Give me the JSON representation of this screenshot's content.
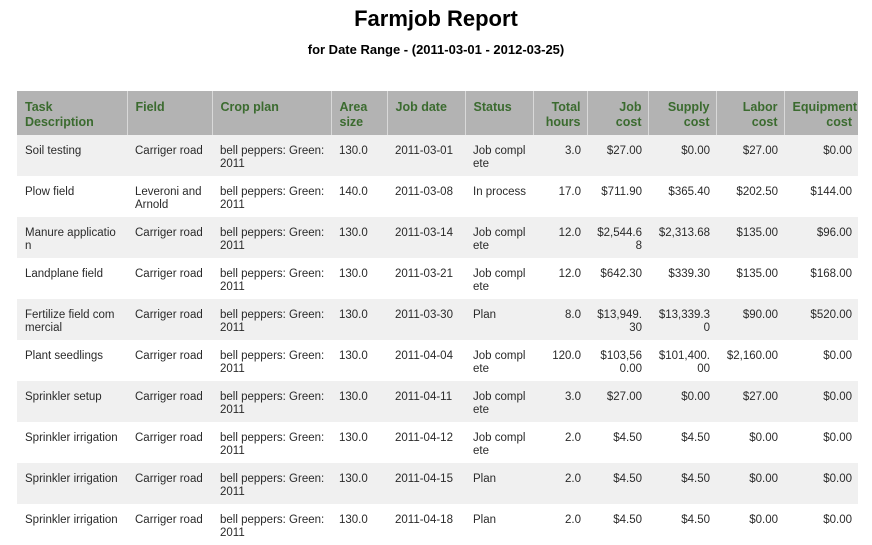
{
  "report": {
    "title": "Farmjob Report",
    "subtitle": "for Date Range - (2011-03-01 - 2012-03-25)"
  },
  "columns": [
    {
      "label": "Task Description",
      "align": "left"
    },
    {
      "label": "Field",
      "align": "left"
    },
    {
      "label": "Crop plan",
      "align": "left"
    },
    {
      "label": "Area size",
      "align": "left"
    },
    {
      "label": "Job date",
      "align": "left"
    },
    {
      "label": "Status",
      "align": "left"
    },
    {
      "label": "Total hours",
      "align": "right"
    },
    {
      "label": "Job cost",
      "align": "right"
    },
    {
      "label": "Supply cost",
      "align": "right"
    },
    {
      "label": "Labor cost",
      "align": "right"
    },
    {
      "label": "Equipment cost",
      "align": "right"
    }
  ],
  "rows": [
    [
      "Soil testing",
      "Carriger road",
      "bell peppers: Green: 2011",
      "130.0",
      "2011-03-01",
      "Job complete",
      "3.0",
      "$27.00",
      "$0.00",
      "$27.00",
      "$0.00"
    ],
    [
      "Plow field",
      "Leveroni and Arnold",
      "bell peppers: Green: 2011",
      "140.0",
      "2011-03-08",
      "In process",
      "17.0",
      "$711.90",
      "$365.40",
      "$202.50",
      "$144.00"
    ],
    [
      "Manure application",
      "Carriger road",
      "bell peppers: Green: 2011",
      "130.0",
      "2011-03-14",
      "Job complete",
      "12.0",
      "$2,544.68",
      "$2,313.68",
      "$135.00",
      "$96.00"
    ],
    [
      "Landplane field",
      "Carriger road",
      "bell peppers: Green: 2011",
      "130.0",
      "2011-03-21",
      "Job complete",
      "12.0",
      "$642.30",
      "$339.30",
      "$135.00",
      "$168.00"
    ],
    [
      "Fertilize field commercial",
      "Carriger road",
      "bell peppers: Green: 2011",
      "130.0",
      "2011-03-30",
      "Plan",
      "8.0",
      "$13,949.30",
      "$13,339.30",
      "$90.00",
      "$520.00"
    ],
    [
      "Plant seedlings",
      "Carriger road",
      "bell peppers: Green: 2011",
      "130.0",
      "2011-04-04",
      "Job complete",
      "120.0",
      "$103,560.00",
      "$101,400.00",
      "$2,160.00",
      "$0.00"
    ],
    [
      "Sprinkler setup",
      "Carriger road",
      "bell peppers: Green: 2011",
      "130.0",
      "2011-04-11",
      "Job complete",
      "3.0",
      "$27.00",
      "$0.00",
      "$27.00",
      "$0.00"
    ],
    [
      "Sprinkler irrigation",
      "Carriger road",
      "bell peppers: Green: 2011",
      "130.0",
      "2011-04-12",
      "Job complete",
      "2.0",
      "$4.50",
      "$4.50",
      "$0.00",
      "$0.00"
    ],
    [
      "Sprinkler irrigation",
      "Carriger road",
      "bell peppers: Green: 2011",
      "130.0",
      "2011-04-15",
      "Plan",
      "2.0",
      "$4.50",
      "$4.50",
      "$0.00",
      "$0.00"
    ],
    [
      "Sprinkler irrigation",
      "Carriger road",
      "bell peppers: Green: 2011",
      "130.0",
      "2011-04-18",
      "Plan",
      "2.0",
      "$4.50",
      "$4.50",
      "$0.00",
      "$0.00"
    ]
  ],
  "colors": {
    "header_bg": "#b3b3b3",
    "header_text": "#3b6b2f",
    "row_alt_bg": "#f0f0f0"
  }
}
